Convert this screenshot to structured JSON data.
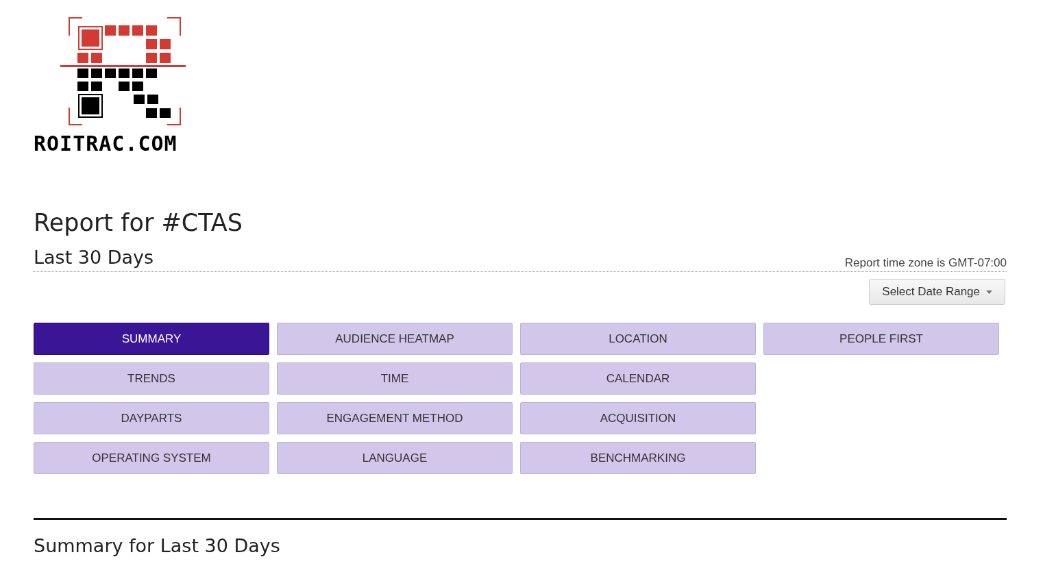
{
  "logo": {
    "text": "ROITRAC.COM"
  },
  "title": "Report for #CTAS",
  "period": "Last 30 Days",
  "time_zone": "Report time zone is GMT-07:00",
  "date_range_button": {
    "label": "Select Date Range"
  },
  "report_tabs": [
    [
      {
        "label": "SUMMARY",
        "selected": true
      },
      {
        "label": "AUDIENCE HEATMAP",
        "selected": false
      },
      {
        "label": "LOCATION",
        "selected": false
      },
      {
        "label": "PEOPLE FIRST",
        "selected": false
      }
    ],
    [
      {
        "label": "TRENDS",
        "selected": false
      },
      {
        "label": "TIME",
        "selected": false
      },
      {
        "label": "CALENDAR",
        "selected": false
      }
    ],
    [
      {
        "label": "DAYPARTS",
        "selected": false
      },
      {
        "label": "ENGAGEMENT METHOD",
        "selected": false
      },
      {
        "label": "ACQUISITION",
        "selected": false
      }
    ],
    [
      {
        "label": "OPERATING SYSTEM",
        "selected": false
      },
      {
        "label": "LANGUAGE",
        "selected": false
      },
      {
        "label": "BENCHMARKING",
        "selected": false
      }
    ]
  ],
  "section_heading": "Summary for Last 30 Days"
}
